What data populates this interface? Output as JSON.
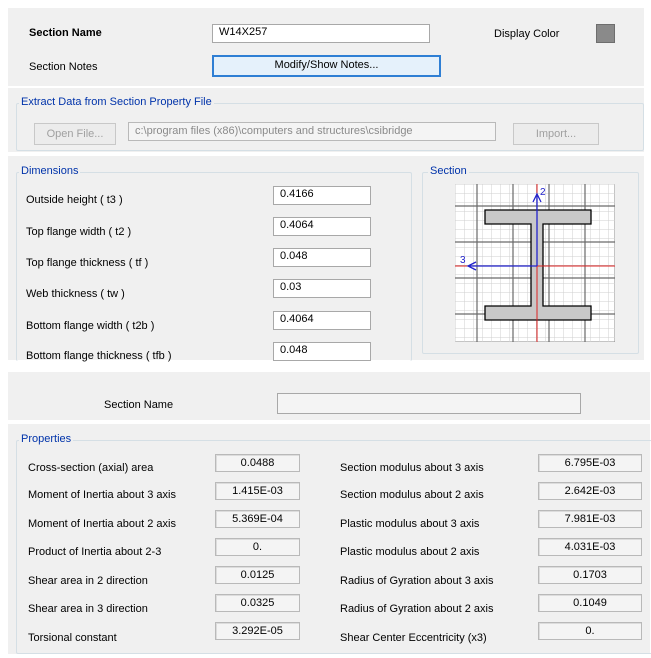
{
  "top": {
    "section_name_label": "Section Name",
    "section_name_value": "W14X257",
    "display_color_label": "Display Color",
    "display_color": "#8a8a8a",
    "section_notes_label": "Section Notes",
    "notes_button": "Modify/Show Notes..."
  },
  "extract": {
    "title": "Extract Data from Section Property File",
    "open_button": "Open File...",
    "path": "c:\\program files (x86)\\computers and structures\\csibridge",
    "import_button": "Import..."
  },
  "dimensions": {
    "title": "Dimensions",
    "rows": [
      {
        "label": "Outside height  ( t3 )",
        "value": "0.4166"
      },
      {
        "label": "Top flange width  ( t2 )",
        "value": "0.4064"
      },
      {
        "label": "Top flange thickness  ( tf )",
        "value": "0.048"
      },
      {
        "label": "Web thickness  ( tw )",
        "value": "0.03"
      },
      {
        "label": "Bottom flange width  ( t2b )",
        "value": "0.4064"
      },
      {
        "label": "Bottom flange thickness  ( tfb )",
        "value": "0.048"
      }
    ]
  },
  "section_preview": {
    "title": "Section",
    "axis2_label": "2",
    "axis3_label": "3",
    "shape_fill": "#c8c8c8",
    "axis_color": "#2222cc",
    "centerline_color": "#dd2222"
  },
  "props_header": {
    "section_name_label": "Section Name",
    "section_name_value": ""
  },
  "properties": {
    "title": "Properties",
    "left": [
      {
        "label": "Cross-section (axial) area",
        "value": "0.0488"
      },
      {
        "label": "Moment of Inertia about 3 axis",
        "value": "1.415E-03"
      },
      {
        "label": "Moment of Inertia about 2 axis",
        "value": "5.369E-04"
      },
      {
        "label": "Product of Inertia about 2-3",
        "value": "0."
      },
      {
        "label": "Shear area in 2 direction",
        "value": "0.0125"
      },
      {
        "label": "Shear area in 3 direction",
        "value": "0.0325"
      },
      {
        "label": "Torsional constant",
        "value": "3.292E-05"
      }
    ],
    "right": [
      {
        "label": "Section modulus about 3 axis",
        "value": "6.795E-03"
      },
      {
        "label": "Section modulus about 2 axis",
        "value": "2.642E-03"
      },
      {
        "label": "Plastic modulus about 3 axis",
        "value": "7.981E-03"
      },
      {
        "label": "Plastic modulus about 2 axis",
        "value": "4.031E-03"
      },
      {
        "label": "Radius of Gyration about 3 axis",
        "value": "0.1703"
      },
      {
        "label": "Radius of Gyration about 2 axis",
        "value": "0.1049"
      },
      {
        "label": "Shear Center Eccentricity (x3)",
        "value": "0."
      }
    ]
  }
}
